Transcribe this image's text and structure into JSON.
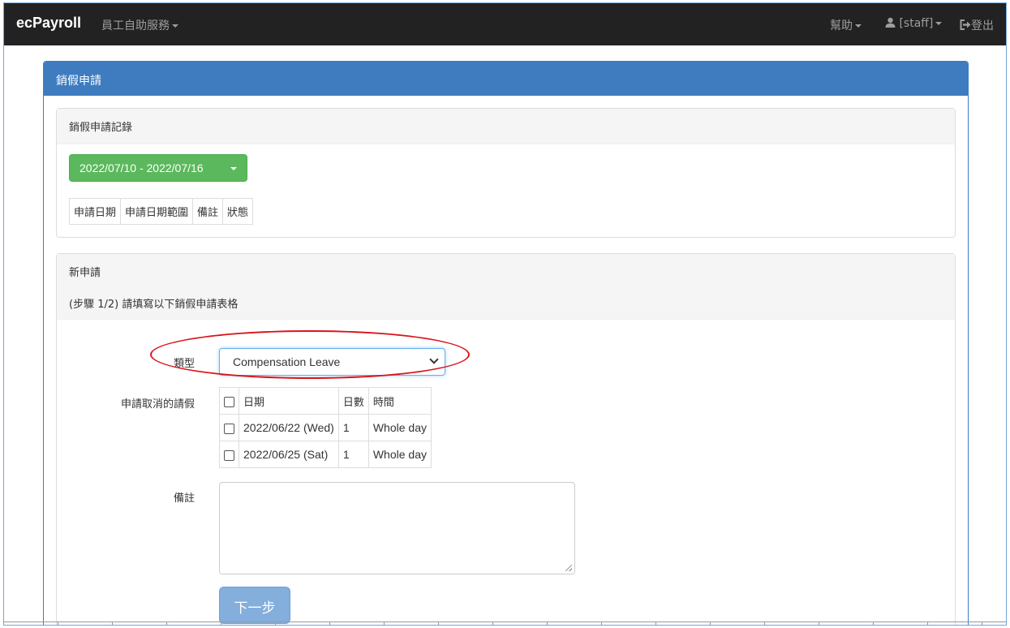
{
  "navbar": {
    "brand": "ecPayroll",
    "self_service": "員工自助服務",
    "help": "幫助",
    "user": "[staff]",
    "logout": "登出"
  },
  "page": {
    "title": "銷假申請"
  },
  "history": {
    "heading": "銷假申請記錄",
    "date_range": "2022/07/10 - 2022/07/16",
    "columns": [
      "申請日期",
      "申請日期範圍",
      "備註",
      "狀態"
    ]
  },
  "new_request": {
    "heading": "新申請",
    "instruction": "(步驟 1/2) 請填寫以下銷假申請表格",
    "type_label": "類型",
    "type_value": "Compensation Leave",
    "cancel_label": "申請取消的請假",
    "table_columns": [
      "日期",
      "日數",
      "時間"
    ],
    "rows": [
      {
        "date": "2022/06/22 (Wed)",
        "days": "1",
        "time": "Whole day"
      },
      {
        "date": "2022/06/25 (Sat)",
        "days": "1",
        "time": "Whole day"
      }
    ],
    "remarks_label": "備註",
    "next_button": "下一步"
  },
  "colors": {
    "navbar": "#222222",
    "primary": "#3e7cbf",
    "success": "#5cb85c",
    "annotation": "#d9141b"
  }
}
